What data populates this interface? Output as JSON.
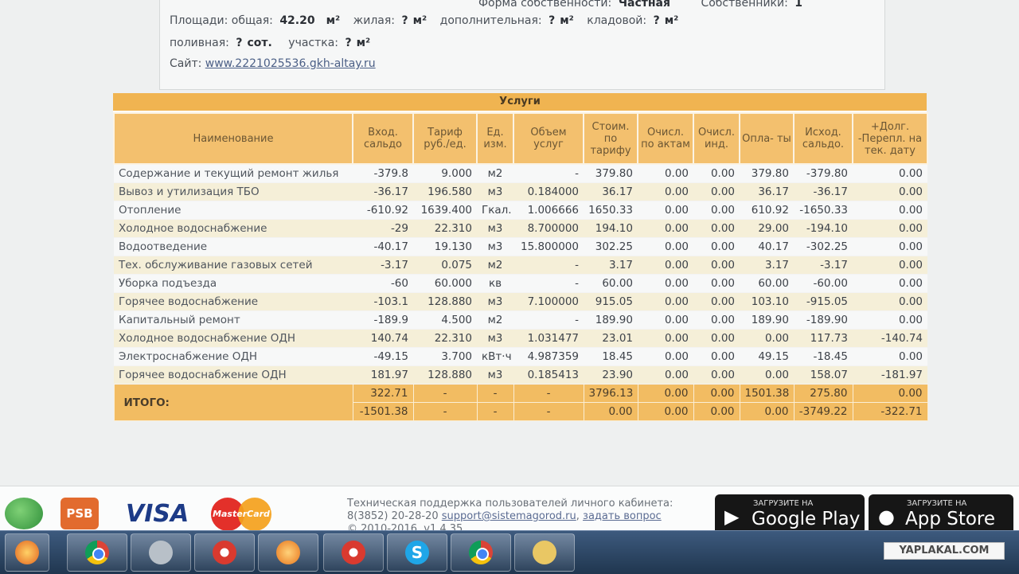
{
  "info": {
    "ownership_label": "Форма собственности:",
    "ownership_value": "Частная",
    "owners_label": "Собственники:",
    "owners_value": "1",
    "area_label": "Площади: общая:",
    "area_total": "42.20",
    "unit_m2": "м²",
    "living_label": "жилая:",
    "living_value": "?",
    "extra_label": "дополнительная:",
    "extra_value": "?",
    "storage_label": "кладовой:",
    "storage_value": "?",
    "irrigated_label": "поливная:",
    "irrigated_value": "?",
    "unit_sot": "сот.",
    "plot_label": "участка:",
    "plot_value": "?",
    "site_label": "Сайт:",
    "site_link": "www.2221025536.gkh-altay.ru"
  },
  "services": {
    "caption": "Услуги",
    "headers": [
      "Наименование",
      "Вход. сальдо",
      "Тариф руб./ед.",
      "Ед. изм.",
      "Объем услуг",
      "Стоим. по тарифу",
      "Очисл. по актам",
      "Очисл. инд.",
      "Опла- ты",
      "Исход. сальдо.",
      "+Долг. -Перепл. на тек. дату"
    ],
    "rows": [
      [
        "Содержание и текущий ремонт жилья",
        "-379.8",
        "9.000",
        "м2",
        "-",
        "379.80",
        "0.00",
        "0.00",
        "379.80",
        "-379.80",
        "0.00"
      ],
      [
        "Вывоз и утилизация ТБО",
        "-36.17",
        "196.580",
        "м3",
        "0.184000",
        "36.17",
        "0.00",
        "0.00",
        "36.17",
        "-36.17",
        "0.00"
      ],
      [
        "Отопление",
        "-610.92",
        "1639.400",
        "Гкал.",
        "1.006666",
        "1650.33",
        "0.00",
        "0.00",
        "610.92",
        "-1650.33",
        "0.00"
      ],
      [
        "Холодное водоснабжение",
        "-29",
        "22.310",
        "м3",
        "8.700000",
        "194.10",
        "0.00",
        "0.00",
        "29.00",
        "-194.10",
        "0.00"
      ],
      [
        "Водоотведение",
        "-40.17",
        "19.130",
        "м3",
        "15.800000",
        "302.25",
        "0.00",
        "0.00",
        "40.17",
        "-302.25",
        "0.00"
      ],
      [
        "Тех. обслуживание газовых сетей",
        "-3.17",
        "0.075",
        "м2",
        "-",
        "3.17",
        "0.00",
        "0.00",
        "3.17",
        "-3.17",
        "0.00"
      ],
      [
        "Уборка подъезда",
        "-60",
        "60.000",
        "кв",
        "-",
        "60.00",
        "0.00",
        "0.00",
        "60.00",
        "-60.00",
        "0.00"
      ],
      [
        "Горячее водоснабжение",
        "-103.1",
        "128.880",
        "м3",
        "7.100000",
        "915.05",
        "0.00",
        "0.00",
        "103.10",
        "-915.05",
        "0.00"
      ],
      [
        "Капитальный ремонт",
        "-189.9",
        "4.500",
        "м2",
        "-",
        "189.90",
        "0.00",
        "0.00",
        "189.90",
        "-189.90",
        "0.00"
      ],
      [
        "Холодное водоснабжение ОДН",
        "140.74",
        "22.310",
        "м3",
        "1.031477",
        "23.01",
        "0.00",
        "0.00",
        "0.00",
        "117.73",
        "-140.74"
      ],
      [
        "Электроснабжение ОДН",
        "-49.15",
        "3.700",
        "кВт·ч",
        "4.987359",
        "18.45",
        "0.00",
        "0.00",
        "49.15",
        "-18.45",
        "0.00"
      ],
      [
        "Горячее водоснабжение ОДН",
        "181.97",
        "128.880",
        "м3",
        "0.185413",
        "23.90",
        "0.00",
        "0.00",
        "0.00",
        "158.07",
        "-181.97"
      ]
    ],
    "total_label": "ИТОГО:",
    "total_rows": [
      [
        "322.71",
        "-",
        "-",
        "-",
        "3796.13",
        "0.00",
        "0.00",
        "1501.38",
        "275.80",
        "0.00"
      ],
      [
        "-1501.38",
        "-",
        "-",
        "-",
        "0.00",
        "0.00",
        "0.00",
        "0.00",
        "-3749.22",
        "-322.71"
      ]
    ]
  },
  "footer": {
    "psb_logo": "PSB",
    "visa": "VISA",
    "mastercard": "MasterCard",
    "support_line1": "Техническая поддержка пользователей личного кабинета:",
    "support_phone": "8(3852) 20-28-20",
    "support_email": "support@sistemagorod.ru",
    "support_ask": "задать вопрос",
    "copyright": "© 2010-2016, v1.4.35",
    "google_small": "ЗАГРУЗИТЕ НА",
    "google_big": "Google Play",
    "apple_small": "ЗАГРУЗИТЕ НА",
    "apple_big": "App Store"
  },
  "watermark": "YAPLAKAL.COM",
  "icons": [
    "sberbank-logo",
    "psb-logo",
    "visa-logo",
    "mastercard-logo",
    "google-play-icon",
    "apple-icon",
    "chrome-icon",
    "skype-icon",
    "printer-icon",
    "folder-icon"
  ]
}
